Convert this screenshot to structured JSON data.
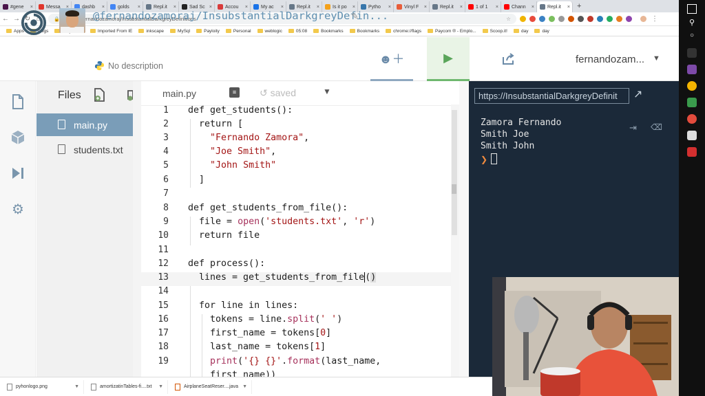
{
  "browser": {
    "tabs": [
      {
        "label": "#gene",
        "color": "#4a154b"
      },
      {
        "label": "Messa",
        "color": "#e0362c"
      },
      {
        "label": "dashb",
        "color": "#4285f4"
      },
      {
        "label": "golds",
        "color": "#4285f4"
      },
      {
        "label": "Repl.it",
        "color": "#667788"
      },
      {
        "label": "Sad Sc",
        "color": "#222222"
      },
      {
        "label": "Accou",
        "color": "#d83b3b"
      },
      {
        "label": "My ac",
        "color": "#1a73e8"
      },
      {
        "label": "Repl.it",
        "color": "#667788"
      },
      {
        "label": "Is it po",
        "color": "#f4a11a"
      },
      {
        "label": "Pytho",
        "color": "#3776ab"
      },
      {
        "label": "Vinyl F",
        "color": "#e85d3a"
      },
      {
        "label": "Repl.it",
        "color": "#667788"
      },
      {
        "label": "1 of 1",
        "color": "#ff0000"
      },
      {
        "label": "Chann",
        "color": "#ff0000"
      },
      {
        "label": "Repl.it",
        "color": "#667788"
      }
    ],
    "url": "repl.it/@fernandozamoraj/InsubstantialDarkgreyDefinitions",
    "bookmarks": [
      "Apps",
      "blogs",
      "daily reads",
      "Imported From IE",
      "inkscape",
      "MySql",
      "Payloity",
      "Personal",
      "weblogic",
      "05:08",
      "Bookmarks",
      "Bookmarks",
      "chrome://flags",
      "Paycom ® - Emplo...",
      "Scoop.it!",
      "day",
      "day"
    ]
  },
  "repl": {
    "name": "@fernandozamoraj/InsubstantialDarkgreyDefin...",
    "description": "No description",
    "username": "fernandozam..."
  },
  "files": {
    "title": "Files",
    "items": [
      "main.py",
      "students.txt"
    ]
  },
  "editor": {
    "tab": "main.py",
    "status": "saved",
    "lines": [
      "1",
      "2",
      "3",
      "4",
      "5",
      "6",
      "7",
      "8",
      "9",
      "10",
      "11",
      "12",
      "13",
      "14",
      "15",
      "16",
      "17",
      "18",
      "19"
    ]
  },
  "console": {
    "url": "https://InsubstantialDarkgreyDefinit",
    "output": [
      "Zamora Fernando",
      "Smith Joe",
      "Smith John"
    ]
  },
  "downloads": [
    "pyhonlogo.png",
    "amortizatinTables-fi....txt",
    "AirplaneSeatReser....java"
  ]
}
